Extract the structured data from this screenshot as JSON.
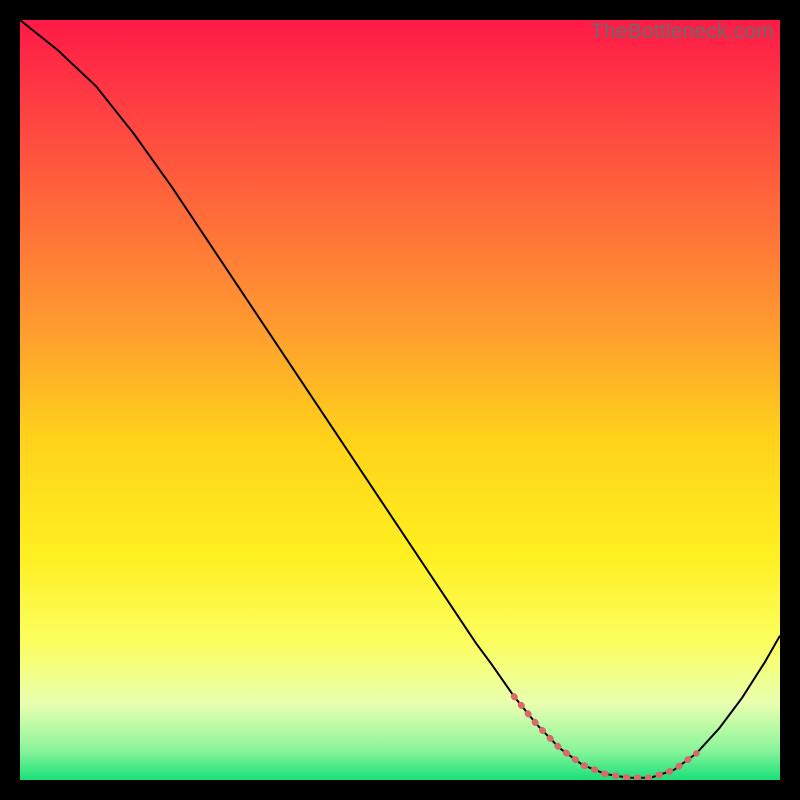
{
  "watermark": "TheBottleneck.com",
  "chart_data": {
    "type": "line",
    "title": "",
    "xlabel": "",
    "ylabel": "",
    "xlim": [
      0,
      100
    ],
    "ylim": [
      0,
      100
    ],
    "background_gradient": {
      "stops": [
        {
          "offset": 0.0,
          "color": "#ff1a47"
        },
        {
          "offset": 0.1,
          "color": "#ff3a43"
        },
        {
          "offset": 0.25,
          "color": "#ff6a3a"
        },
        {
          "offset": 0.4,
          "color": "#ff9a30"
        },
        {
          "offset": 0.55,
          "color": "#ffd21a"
        },
        {
          "offset": 0.7,
          "color": "#ffef20"
        },
        {
          "offset": 0.82,
          "color": "#fcff60"
        },
        {
          "offset": 0.9,
          "color": "#e8ffb0"
        },
        {
          "offset": 0.96,
          "color": "#8cf59a"
        },
        {
          "offset": 1.0,
          "color": "#18e07a"
        }
      ]
    },
    "series": [
      {
        "name": "bottleneck-curve",
        "color": "#000000",
        "width": 2.0,
        "x": [
          0,
          5,
          10,
          15,
          20,
          25,
          30,
          35,
          40,
          45,
          50,
          55,
          60,
          62,
          65,
          68,
          71,
          74,
          77,
          80,
          83,
          86,
          89,
          92,
          95,
          98,
          100
        ],
        "y": [
          100,
          96,
          91.3,
          85,
          78,
          70.5,
          63,
          55.5,
          48,
          40.5,
          33,
          25.5,
          18,
          15.3,
          11,
          7.3,
          4.2,
          2.0,
          0.8,
          0.3,
          0.3,
          1.3,
          3.5,
          6.8,
          10.8,
          15.5,
          19
        ]
      },
      {
        "name": "optimal-range-marker",
        "color": "#d86a6a",
        "width": 6.5,
        "dash": [
          1,
          10
        ],
        "linecap": "round",
        "x": [
          65,
          68,
          71,
          74,
          77,
          80,
          83,
          86,
          89
        ],
        "y": [
          11,
          7.3,
          4.2,
          2.0,
          0.8,
          0.3,
          0.3,
          1.3,
          3.5
        ]
      }
    ]
  }
}
